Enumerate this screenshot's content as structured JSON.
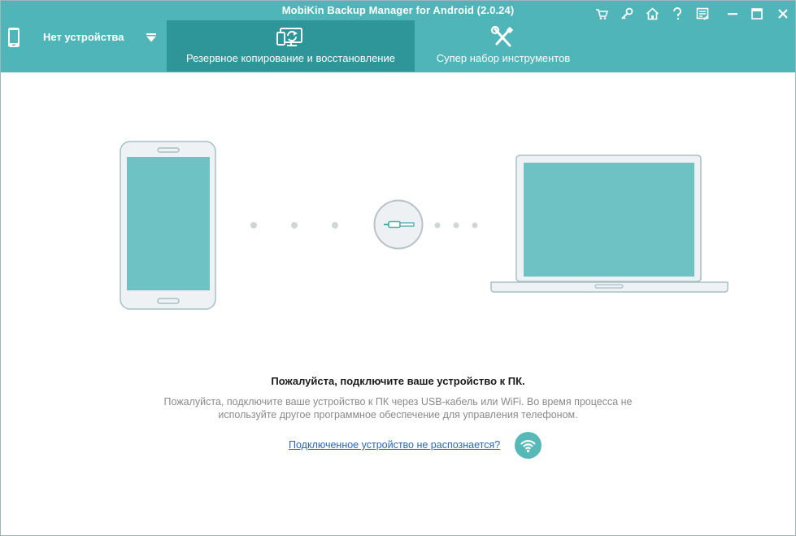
{
  "app": {
    "title": "MobiKin Backup Manager for Android (2.0.24)"
  },
  "device": {
    "label": "Нет устройства",
    "icon": "phone-icon"
  },
  "tabs": [
    {
      "label": "Резервное копирование и восстановление",
      "icon": "backup-restore-icon",
      "active": true
    },
    {
      "label": "Супер набор инструментов",
      "icon": "tools-icon",
      "active": false
    }
  ],
  "window_controls": [
    "cart-icon",
    "key-icon",
    "home-icon",
    "help-icon",
    "feedback-icon",
    "minimize-icon",
    "maximize-icon",
    "close-icon"
  ],
  "message": {
    "title": "Пожалуйста, подключите ваше устройство к ПК.",
    "body_line1": "Пожалуйста, подключите ваше устройство к ПК через USB-кабель или WiFi. Во время процесса не",
    "body_line2": "используйте другое программное обеспечение для управления телефоном.",
    "help_link": "Подключенное устройство не распознается?"
  },
  "colors": {
    "header": "#4fb5b9",
    "active_tab": "#2e9599",
    "screen": "#6fc2c3",
    "link": "#2a67b4"
  }
}
